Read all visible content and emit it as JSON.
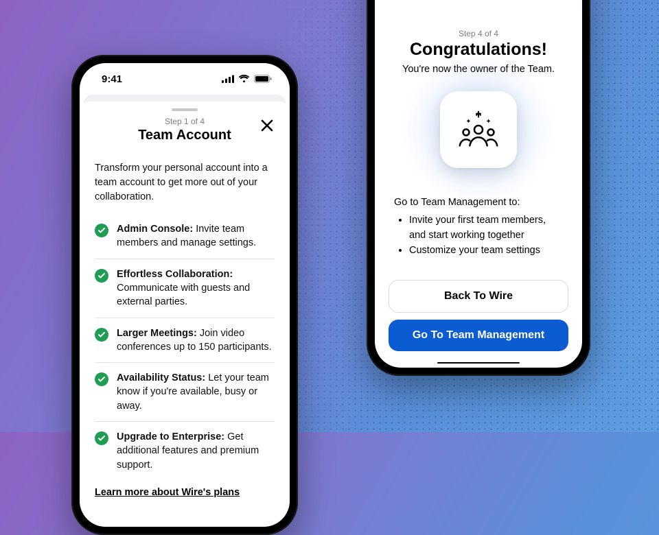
{
  "status": {
    "time": "9:41"
  },
  "left": {
    "step_label": "Step 1 of 4",
    "title": "Team Account",
    "intro": "Transform your personal account into a team account to get more out of your collaboration.",
    "features": [
      {
        "title": "Admin Console:",
        "desc": " Invite team members and manage settings."
      },
      {
        "title": "Effortless Collaboration:",
        "desc": " Communicate with guests and external parties."
      },
      {
        "title": "Larger Meetings:",
        "desc": " Join video conferences up to 150 participants."
      },
      {
        "title": "Availability Status:",
        "desc": " Let your team know if you're available, busy or away."
      },
      {
        "title": "Upgrade to Enterprise:",
        "desc": " Get additional features and premium support."
      }
    ],
    "learn_more": "Learn more about Wire's plans"
  },
  "right": {
    "step_label": "Step 4 of 4",
    "title": "Congratulations!",
    "subtitle": "You're now the owner of the Team.",
    "mgmt_lead": "Go to Team Management to:",
    "mgmt_items": [
      "Invite your first team members, and start working together",
      "Customize your team settings"
    ],
    "back_label": "Back To Wire",
    "go_label": "Go To Team Management"
  }
}
